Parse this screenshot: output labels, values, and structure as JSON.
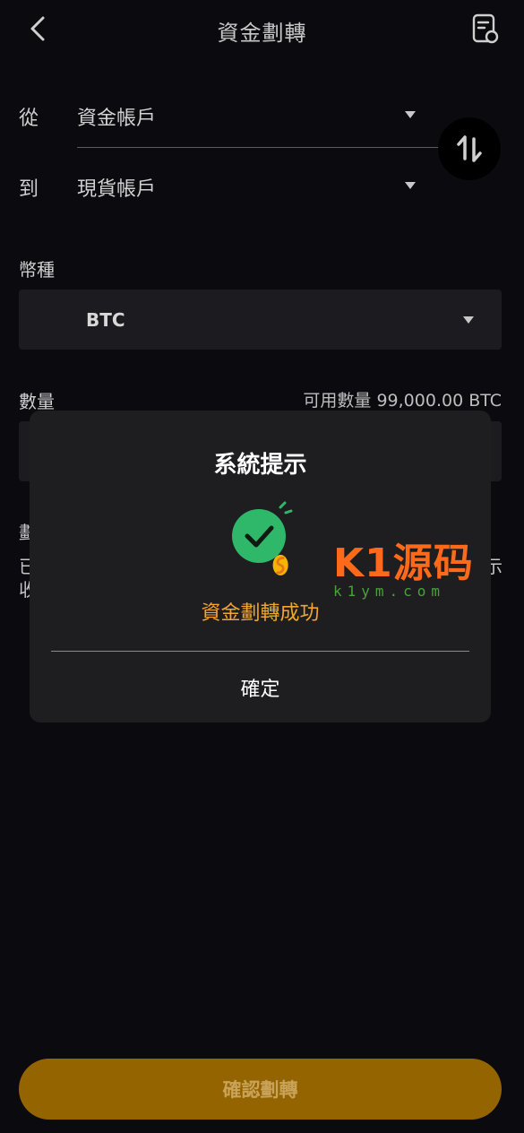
{
  "header": {
    "title": "資金劃轉"
  },
  "transfer": {
    "from_label": "從",
    "from_value": "資金帳戶",
    "to_label": "到",
    "to_value": "現貨帳戶"
  },
  "currency": {
    "label": "幣種",
    "value": "BTC"
  },
  "amount": {
    "label": "數量",
    "available": "可用數量 99,000.00 BTC"
  },
  "behind_text": {
    "line1": "劃",
    "line2": "已",
    "line3": "收",
    "line2_right": "示"
  },
  "confirm_button": {
    "label": "確認劃轉"
  },
  "dialog": {
    "title": "系統提示",
    "message": "資金劃轉成功",
    "ok_label": "確定"
  },
  "watermark": {
    "brand": "K1源码",
    "url": "k1ym.com"
  },
  "colors": {
    "accent": "#946400",
    "success": "#2fb86a",
    "message": "#f2a62b"
  }
}
